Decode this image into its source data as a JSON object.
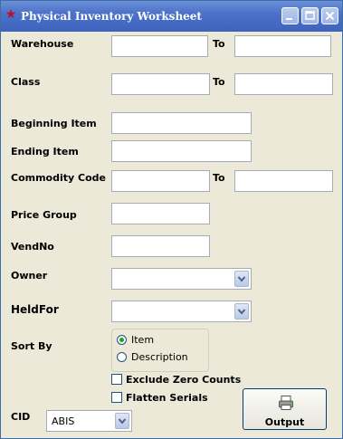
{
  "window": {
    "title": "Physical Inventory Worksheet",
    "title_bar_color": "#3d63be",
    "controls": {
      "minimize": "minimize-icon",
      "maximize": "maximize-icon",
      "close": "close-icon"
    }
  },
  "form": {
    "warehouse": {
      "label": "Warehouse",
      "to_label": "To",
      "from_value": "",
      "to_value": ""
    },
    "class": {
      "label": "Class",
      "to_label": "To",
      "from_value": "",
      "to_value": ""
    },
    "beginning_item": {
      "label": "Beginning Item",
      "value": ""
    },
    "ending_item": {
      "label": "Ending Item",
      "value": ""
    },
    "commodity_code": {
      "label": "Commodity Code",
      "to_label": "To",
      "from_value": "",
      "to_value": ""
    },
    "price_group": {
      "label": "Price Group",
      "value": ""
    },
    "vendno": {
      "label": "VendNo",
      "value": ""
    },
    "owner": {
      "label": "Owner",
      "value": ""
    },
    "heldfor": {
      "label": "HeldFor",
      "value": ""
    },
    "sort_by": {
      "label": "Sort By",
      "options": [
        "Item",
        "Description"
      ],
      "selected": "Item"
    },
    "exclude_zero_counts": {
      "label": "Exclude Zero Counts",
      "checked": false
    },
    "flatten_serials": {
      "label": "Flatten Serials",
      "checked": false
    },
    "cid": {
      "label": "CID",
      "value": "ABIS"
    }
  },
  "buttons": {
    "output_label": "Output"
  }
}
